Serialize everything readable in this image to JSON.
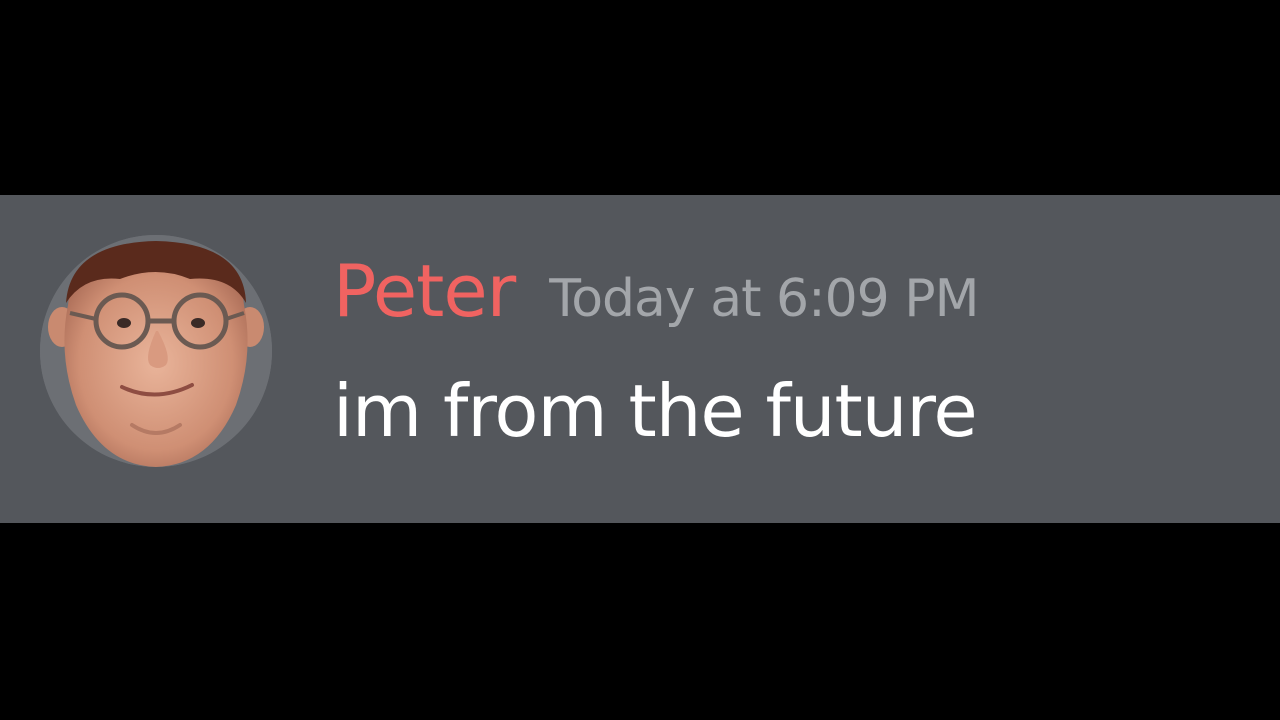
{
  "message": {
    "author": {
      "name": "Peter",
      "name_color": "#f06361",
      "avatar": "peter-face-avatar"
    },
    "timestamp": "Today at 6:09 PM",
    "content": "im from the future"
  },
  "colors": {
    "background": "#000000",
    "message_background": "#54575c",
    "timestamp": "#a3a6aa",
    "text": "#ffffff"
  }
}
